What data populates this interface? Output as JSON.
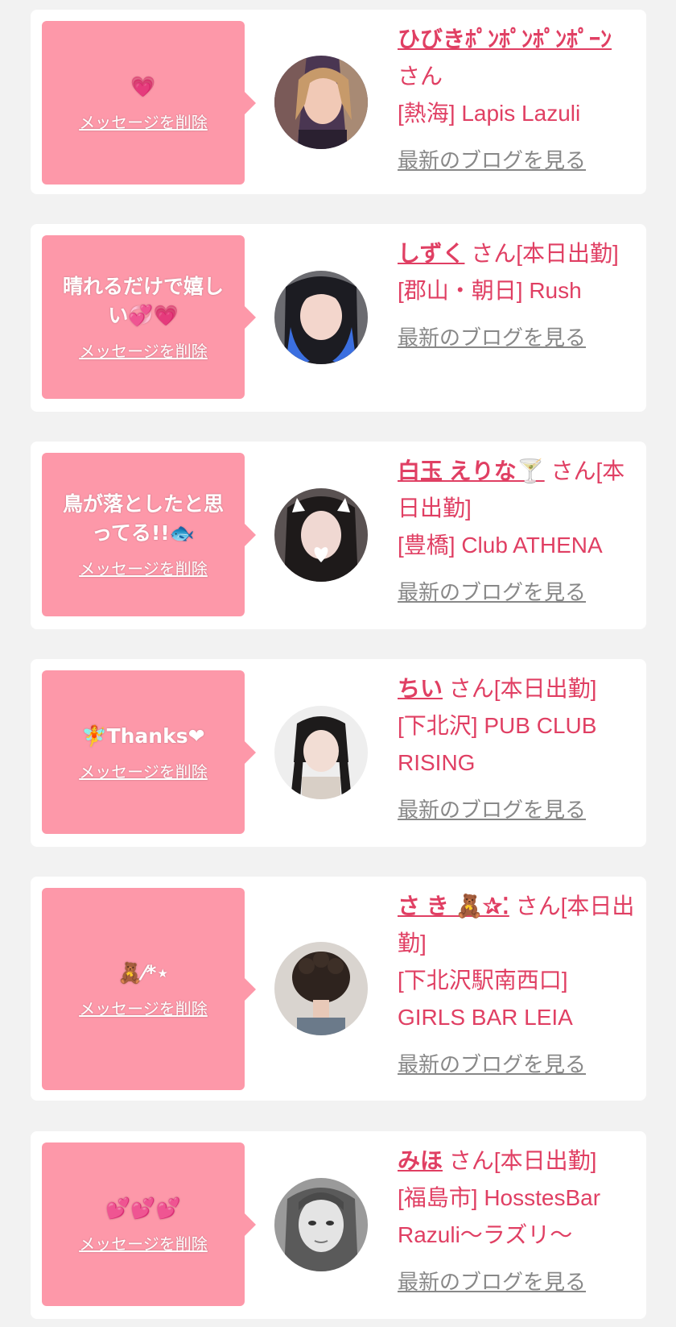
{
  "delete_label": "メッセージを削除",
  "blog_label": "最新のブログを見る",
  "cards": [
    {
      "message": "💗",
      "name": "ひびきﾎﾟﾝﾎﾟﾝﾎﾟﾝﾎﾟｰﾝ",
      "suffix": "さん",
      "shop": "[熱海] Lapis Lazuli"
    },
    {
      "message": "晴れるだけで嬉しい💞💗",
      "name": "しずく",
      "suffix": "さん[本日出勤]",
      "shop": "[郡山・朝日] Rush"
    },
    {
      "message": "鳥が落としたと思ってる!!🐟",
      "name": "白玉 えりな🍸",
      "suffix": "さん[本日出勤]",
      "shop": "[豊橋] Club ATHENA"
    },
    {
      "message": "🧚Thanks❤",
      "name": "ちい",
      "suffix": "さん[本日出勤]",
      "shop": "[下北沢] PUB CLUB RISING"
    },
    {
      "message": "🧸⁄*⋆",
      "name": "さ き 🧸✰⁚",
      "suffix": "さん[本日出勤]",
      "shop": "[下北沢駅南西口] GIRLS BAR LEIA"
    },
    {
      "message": "💕💕💕",
      "name": "みほ",
      "suffix": "さん[本日出勤]",
      "shop": "[福島市] HosstesBar Razuli〜ラズリ〜"
    }
  ],
  "colors": {
    "background": "#f2f2f2",
    "bubble": "#fd98a9",
    "accent_text": "#e03f63",
    "link_gray": "#888888"
  }
}
